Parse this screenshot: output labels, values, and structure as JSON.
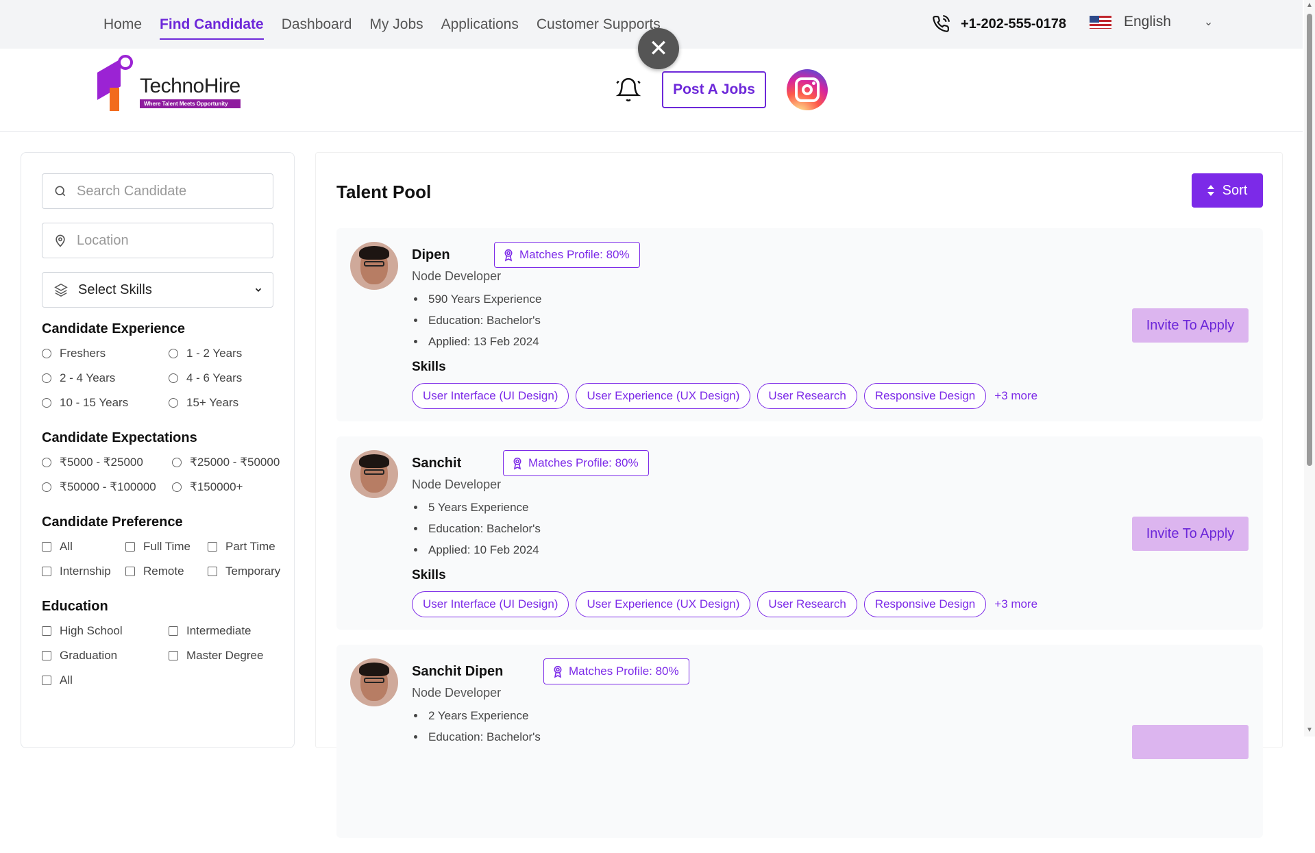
{
  "topnav": {
    "items": [
      "Home",
      "Find Candidate",
      "Dashboard",
      "My Jobs",
      "Applications",
      "Customer Supports"
    ],
    "active_index": 1
  },
  "contact": {
    "phone": "+1-202-555-0178"
  },
  "language": {
    "selected": "English"
  },
  "brand": {
    "name": "TechnoHire",
    "tagline": "Where Talent Meets Opportunity"
  },
  "header": {
    "post_job_label": "Post A Jobs"
  },
  "filters": {
    "search_placeholder": "Search Candidate",
    "location_placeholder": "Location",
    "skills_select": "Select Skills",
    "experience": {
      "title": "Candidate Experience",
      "options": [
        "Freshers",
        "1 - 2 Years",
        "2 - 4 Years",
        "4 - 6 Years",
        "10 - 15 Years",
        "15+ Years"
      ]
    },
    "expectations": {
      "title": "Candidate Expectations",
      "options": [
        "₹5000 - ₹25000",
        "₹25000 - ₹50000",
        "₹50000 - ₹100000",
        "₹150000+"
      ]
    },
    "preference": {
      "title": "Candidate Preference",
      "options": [
        "All",
        "Full Time",
        "Part Time",
        "Internship",
        "Remote",
        "Temporary"
      ]
    },
    "education": {
      "title": "Education",
      "options": [
        "High School",
        "Intermediate",
        "Graduation",
        "Master Degree",
        "All"
      ]
    }
  },
  "main": {
    "title": "Talent Pool",
    "sort_label": "Sort",
    "skills_heading": "Skills",
    "invite_label": "Invite To Apply",
    "candidates": [
      {
        "name": "Dipen",
        "match": "Matches Profile: 80%",
        "role": "Node Developer",
        "experience": "590 Years Experience",
        "education": "Education: Bachelor's",
        "applied": "Applied: 13 Feb 2024",
        "skills": [
          "User Interface (UI Design)",
          "User Experience (UX Design)",
          "User Research",
          "Responsive Design"
        ],
        "more": "+3 more"
      },
      {
        "name": "Sanchit",
        "match": "Matches Profile: 80%",
        "role": "Node Developer",
        "experience": "5 Years Experience",
        "education": "Education: Bachelor's",
        "applied": "Applied: 10 Feb 2024",
        "skills": [
          "User Interface (UI Design)",
          "User Experience (UX Design)",
          "User Research",
          "Responsive Design"
        ],
        "more": "+3 more"
      },
      {
        "name": "Sanchit Dipen",
        "match": "Matches Profile: 80%",
        "role": "Node Developer",
        "experience": "2 Years Experience",
        "education": "Education: Bachelor's",
        "applied": "",
        "skills": [],
        "more": ""
      }
    ]
  },
  "colors": {
    "accent": "#7c2ae8",
    "invite_bg": "#dcb5ef",
    "topbar_bg": "#f3f4f6"
  },
  "icons": {
    "phone": "phone-icon",
    "bell": "bell-icon",
    "search": "search-icon",
    "location": "location-pin-icon",
    "layers": "layers-icon",
    "close": "close-icon",
    "badge": "award-badge-icon",
    "sort": "sort-icon"
  }
}
